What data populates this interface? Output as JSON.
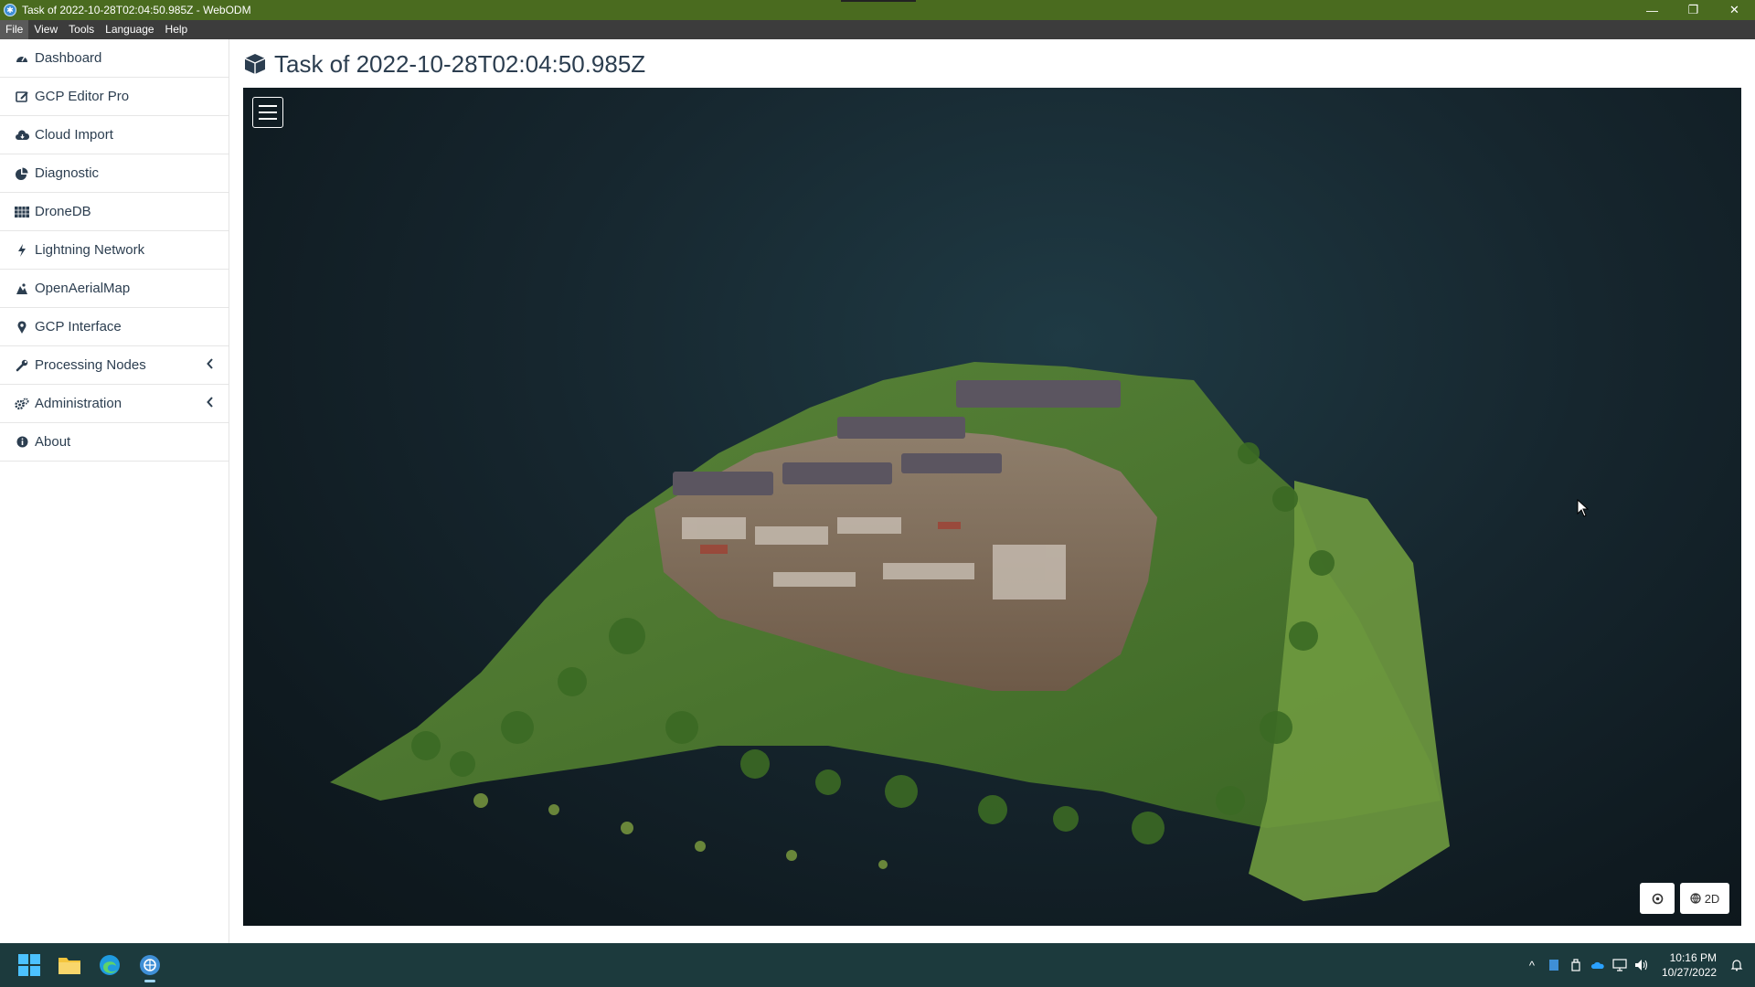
{
  "window": {
    "title": "Task of 2022-10-28T02:04:50.985Z - WebODM",
    "controls": {
      "minimize": "—",
      "restore": "❐",
      "close": "✕"
    }
  },
  "menubar": [
    "File",
    "View",
    "Tools",
    "Language",
    "Help"
  ],
  "sidebar": {
    "items": [
      {
        "label": "Dashboard",
        "icon": "dashboard-icon"
      },
      {
        "label": "GCP Editor Pro",
        "icon": "gcp-editor-icon"
      },
      {
        "label": "Cloud Import",
        "icon": "cloud-icon"
      },
      {
        "label": "Diagnostic",
        "icon": "pie-chart-icon"
      },
      {
        "label": "DroneDB",
        "icon": "grid-icon"
      },
      {
        "label": "Lightning Network",
        "icon": "bolt-icon"
      },
      {
        "label": "OpenAerialMap",
        "icon": "map-icon"
      },
      {
        "label": "GCP Interface",
        "icon": "map-marker-icon"
      },
      {
        "label": "Processing Nodes",
        "icon": "wrench-icon",
        "expandable": true
      },
      {
        "label": "Administration",
        "icon": "cogs-icon",
        "expandable": true
      },
      {
        "label": "About",
        "icon": "info-icon"
      }
    ]
  },
  "page": {
    "title": "Task of 2022-10-28T02:04:50.985Z",
    "title_icon": "cube-icon"
  },
  "viewer": {
    "view_mode_button": "2D",
    "menu_icon": "hamburger-icon",
    "location_icon": "crosshair-icon"
  },
  "taskbar": {
    "apps": [
      "windows-start-icon",
      "file-explorer-icon",
      "edge-browser-icon",
      "webodm-app-icon"
    ],
    "clock": {
      "time": "10:16 PM",
      "date": "10/27/2022"
    }
  },
  "colors": {
    "titlebar": "#4a6b1f",
    "menubar": "#3c3c3c",
    "sidebar_text": "#2c3e50",
    "viewer_bg": "#16262e",
    "taskbar": "#1c3a3d"
  }
}
